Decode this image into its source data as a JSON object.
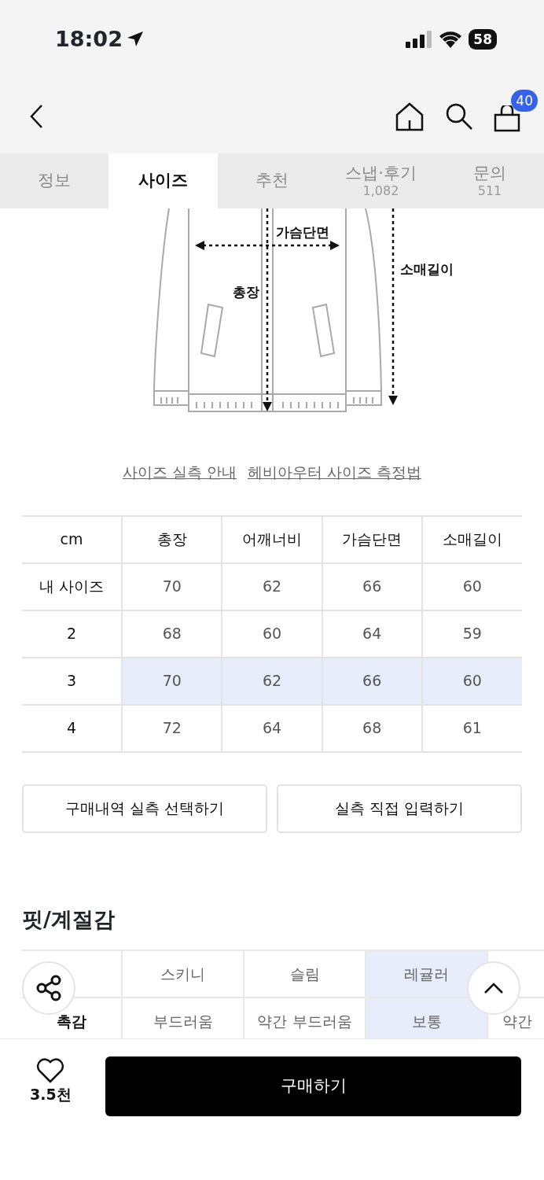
{
  "status_bar": {
    "time": "18:02",
    "battery": "58"
  },
  "header": {
    "cart_count": "40"
  },
  "tabs": [
    {
      "label": "정보",
      "selected": false
    },
    {
      "label": "사이즈",
      "selected": true
    },
    {
      "label": "추천",
      "selected": false
    },
    {
      "label": "스냅·후기",
      "count": "1,082",
      "selected": false
    },
    {
      "label": "문의",
      "count": "511",
      "selected": false
    }
  ],
  "diagram": {
    "labels": [
      "가슴단면",
      "총장",
      "소매길이"
    ]
  },
  "links": [
    "사이즈 실측 안내",
    "헤비아우터 사이즈 측정법"
  ],
  "size_table": {
    "columns": [
      "cm",
      "총장",
      "어깨너비",
      "가슴단면",
      "소매길이"
    ],
    "rows": [
      {
        "cells": [
          "내 사이즈",
          "70",
          "62",
          "66",
          "60"
        ],
        "selected": false
      },
      {
        "cells": [
          "2",
          "68",
          "60",
          "64",
          "59"
        ],
        "selected": false
      },
      {
        "cells": [
          "3",
          "70",
          "62",
          "66",
          "60"
        ],
        "selected": true
      },
      {
        "cells": [
          "4",
          "72",
          "64",
          "68",
          "61"
        ],
        "selected": false
      }
    ]
  },
  "buttons": [
    "구매내역 실측 선택하기",
    "실측 직접 입력하기"
  ],
  "fit_section": {
    "title": "핏/계절감",
    "rows": [
      {
        "cells": [
          {
            "text": "스키니",
            "selected": false
          },
          {
            "text": "슬림",
            "selected": false
          },
          {
            "text": "레귤러",
            "selected": true
          }
        ]
      },
      {
        "label": "촉감",
        "cells": [
          {
            "text": "부드러움",
            "selected": false
          },
          {
            "text": "약간 부드러움",
            "selected": false
          },
          {
            "text": "보통",
            "selected": true
          },
          {
            "text": "약간",
            "selected": false
          }
        ]
      }
    ]
  },
  "bottom_bar": {
    "likes": "3.5천",
    "buy_label": "구매하기"
  }
}
